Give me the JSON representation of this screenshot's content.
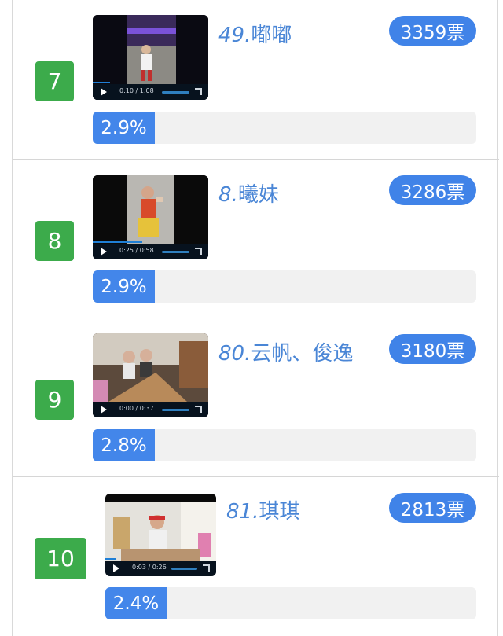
{
  "entries": [
    {
      "rank": "7",
      "number": "49.",
      "name": "嘟嘟",
      "votes": "3359票",
      "percent": "2.9%",
      "percent_value": 2.9,
      "video_time": "0:10 / 1:08",
      "video_progress": 0.15
    },
    {
      "rank": "8",
      "number": "8.",
      "name": "曦妹",
      "votes": "3286票",
      "percent": "2.9%",
      "percent_value": 2.9,
      "video_time": "0:25 / 0:58",
      "video_progress": 0.43
    },
    {
      "rank": "9",
      "number": "80.",
      "name": "云帆、俊逸",
      "votes": "3180票",
      "percent": "2.8%",
      "percent_value": 2.8,
      "video_time": "0:00 / 0:37",
      "video_progress": 0.0
    },
    {
      "rank": "10",
      "number": "81.",
      "name": "琪琪",
      "votes": "2813票",
      "percent": "2.4%",
      "percent_value": 2.4,
      "video_time": "0:03 / 0:26",
      "video_progress": 0.1
    }
  ],
  "colors": {
    "rank_badge": "#3cab4b",
    "vote_pill": "#4083e8",
    "name_text": "#4a86d6",
    "percent_fill": "#4386ea",
    "percent_track": "#f1f1f1"
  }
}
